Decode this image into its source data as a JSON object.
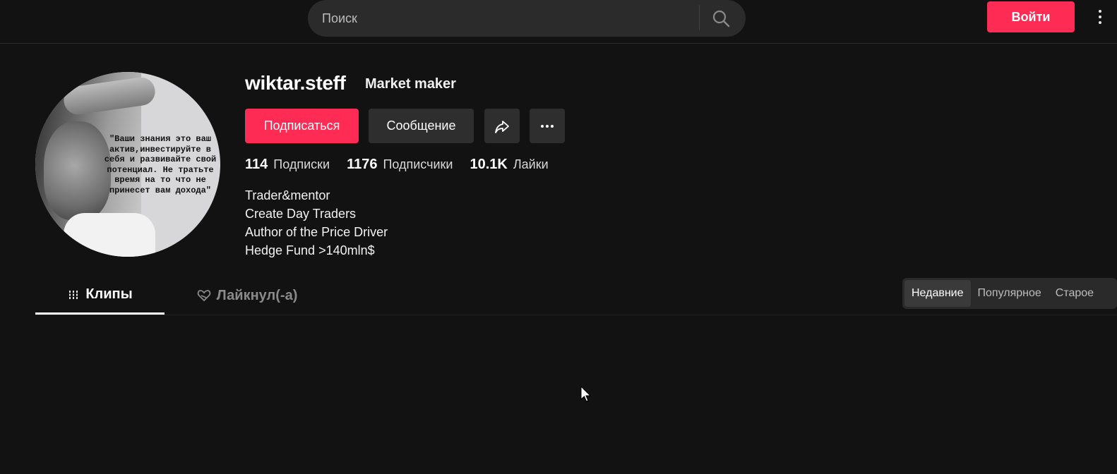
{
  "header": {
    "search_placeholder": "Поиск",
    "login_label": "Войти"
  },
  "profile": {
    "username": "wiktar.steff",
    "nickname": "Market maker",
    "avatar_quote": "\"Ваши знания это ваш актив,инвестируйте в себя и развивайте свой потенциал. Не тратьте время на то что не принесет вам дохода\"",
    "follow_label": "Подписаться",
    "message_label": "Сообщение",
    "stats": [
      {
        "value": "114",
        "label": "Подписки"
      },
      {
        "value": "1176",
        "label": "Подписчики"
      },
      {
        "value": "10.1K",
        "label": "Лайки"
      }
    ],
    "bio": [
      "Trader&mentor",
      "Create Day Traders",
      "Author of the Price Driver",
      "Hedge Fund >140mln$"
    ]
  },
  "tabs": [
    {
      "label": "Клипы",
      "active": true
    },
    {
      "label": "Лайкнул(-а)",
      "active": false
    }
  ],
  "sort": {
    "options": [
      "Недавние",
      "Популярное",
      "Старое"
    ],
    "selected": "Недавние"
  },
  "colors": {
    "accent": "#fe2c55",
    "background": "#121212",
    "button_secondary": "#2e2e2e"
  },
  "icons": {
    "search": "search-icon",
    "share": "share-icon",
    "more": "more-horizontal-icon",
    "clips": "grid-lines-icon",
    "liked": "heart-outline-icon",
    "menu": "kebab-menu-icon"
  }
}
